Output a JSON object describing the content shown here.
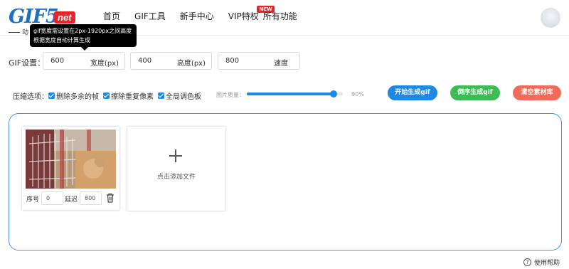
{
  "header": {
    "logo_text": "GIF5",
    "logo_badge": "net",
    "logo_sub": "动",
    "nav": [
      {
        "label": "首页"
      },
      {
        "label": "GIF工具"
      },
      {
        "label": "新手中心"
      },
      {
        "label": "VIP特权",
        "badge": "NEW"
      },
      {
        "label": "所有功能"
      }
    ]
  },
  "tooltip": {
    "line1": "gif宽度需设置在2px-1920px之间高度",
    "line2": "根据宽度自动计算生成"
  },
  "settings": {
    "label": "GIF设置：",
    "width": {
      "value": "600",
      "unit": "宽度(px)"
    },
    "height": {
      "value": "400",
      "unit": "高度(px)"
    },
    "speed": {
      "value": "800",
      "unit": "速度"
    }
  },
  "compress": {
    "label": "压缩选项：",
    "options": [
      "删除多余的帧",
      "擦除重复像素",
      "全局调色板"
    ],
    "quality_label": "图片质量：",
    "quality_value": "90%",
    "quality_fraction": 0.9
  },
  "actions": {
    "start": "开始生成gif",
    "reverse": "倒序生成gif",
    "clear": "清空素材库"
  },
  "colors": {
    "primary": "#1e88e5",
    "green": "#3dbb55",
    "red": "#ef6c5b"
  },
  "frames": [
    {
      "seq_label": "序号",
      "seq_value": "0",
      "delay_label": "延迟",
      "delay_value": "800"
    }
  ],
  "add_file": "点击添加文件",
  "help": "使用帮助"
}
